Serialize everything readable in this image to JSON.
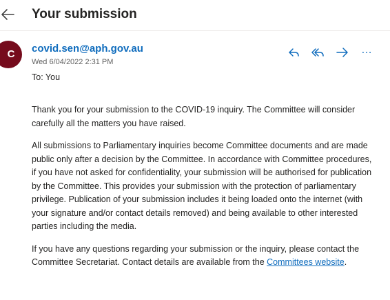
{
  "header": {
    "title": "Your submission",
    "back_icon": "arrow-left-icon"
  },
  "message": {
    "avatar_initial": "C",
    "avatar_color": "#750b1c",
    "sender": "covid.sen@aph.gov.au",
    "date": "Wed 6/04/2022 2:31 PM",
    "to": "To: You",
    "actions": {
      "reply_icon": "reply-icon",
      "reply_all_icon": "reply-all-icon",
      "forward_icon": "forward-icon",
      "more_icon": "more-icon",
      "more_label": "…"
    },
    "paragraphs": [
      "Thank you for your submission to the COVID-19 inquiry. The Committee will consider carefully all the matters you have raised.",
      "All submissions to Parliamentary inquiries become Committee documents and are made public only after a decision by the Committee. In accordance with Committee procedures, if you have not asked for confidentiality, your submission will be authorised for publication by the Committee. This provides your submission with the protection of parliamentary privilege. Publication of your submission includes it being loaded onto the internet (with your signature and/or contact details removed) and being available to other interested parties including the media."
    ],
    "last_paragraph": {
      "text_before": "If you have any questions regarding your submission or the inquiry, please contact the Committee Secretariat.  Contact details are available from the ",
      "link_text": "Committees website",
      "text_after": "."
    }
  },
  "colors": {
    "accent": "#0f6cbd",
    "text": "#252423",
    "muted": "#616161"
  }
}
